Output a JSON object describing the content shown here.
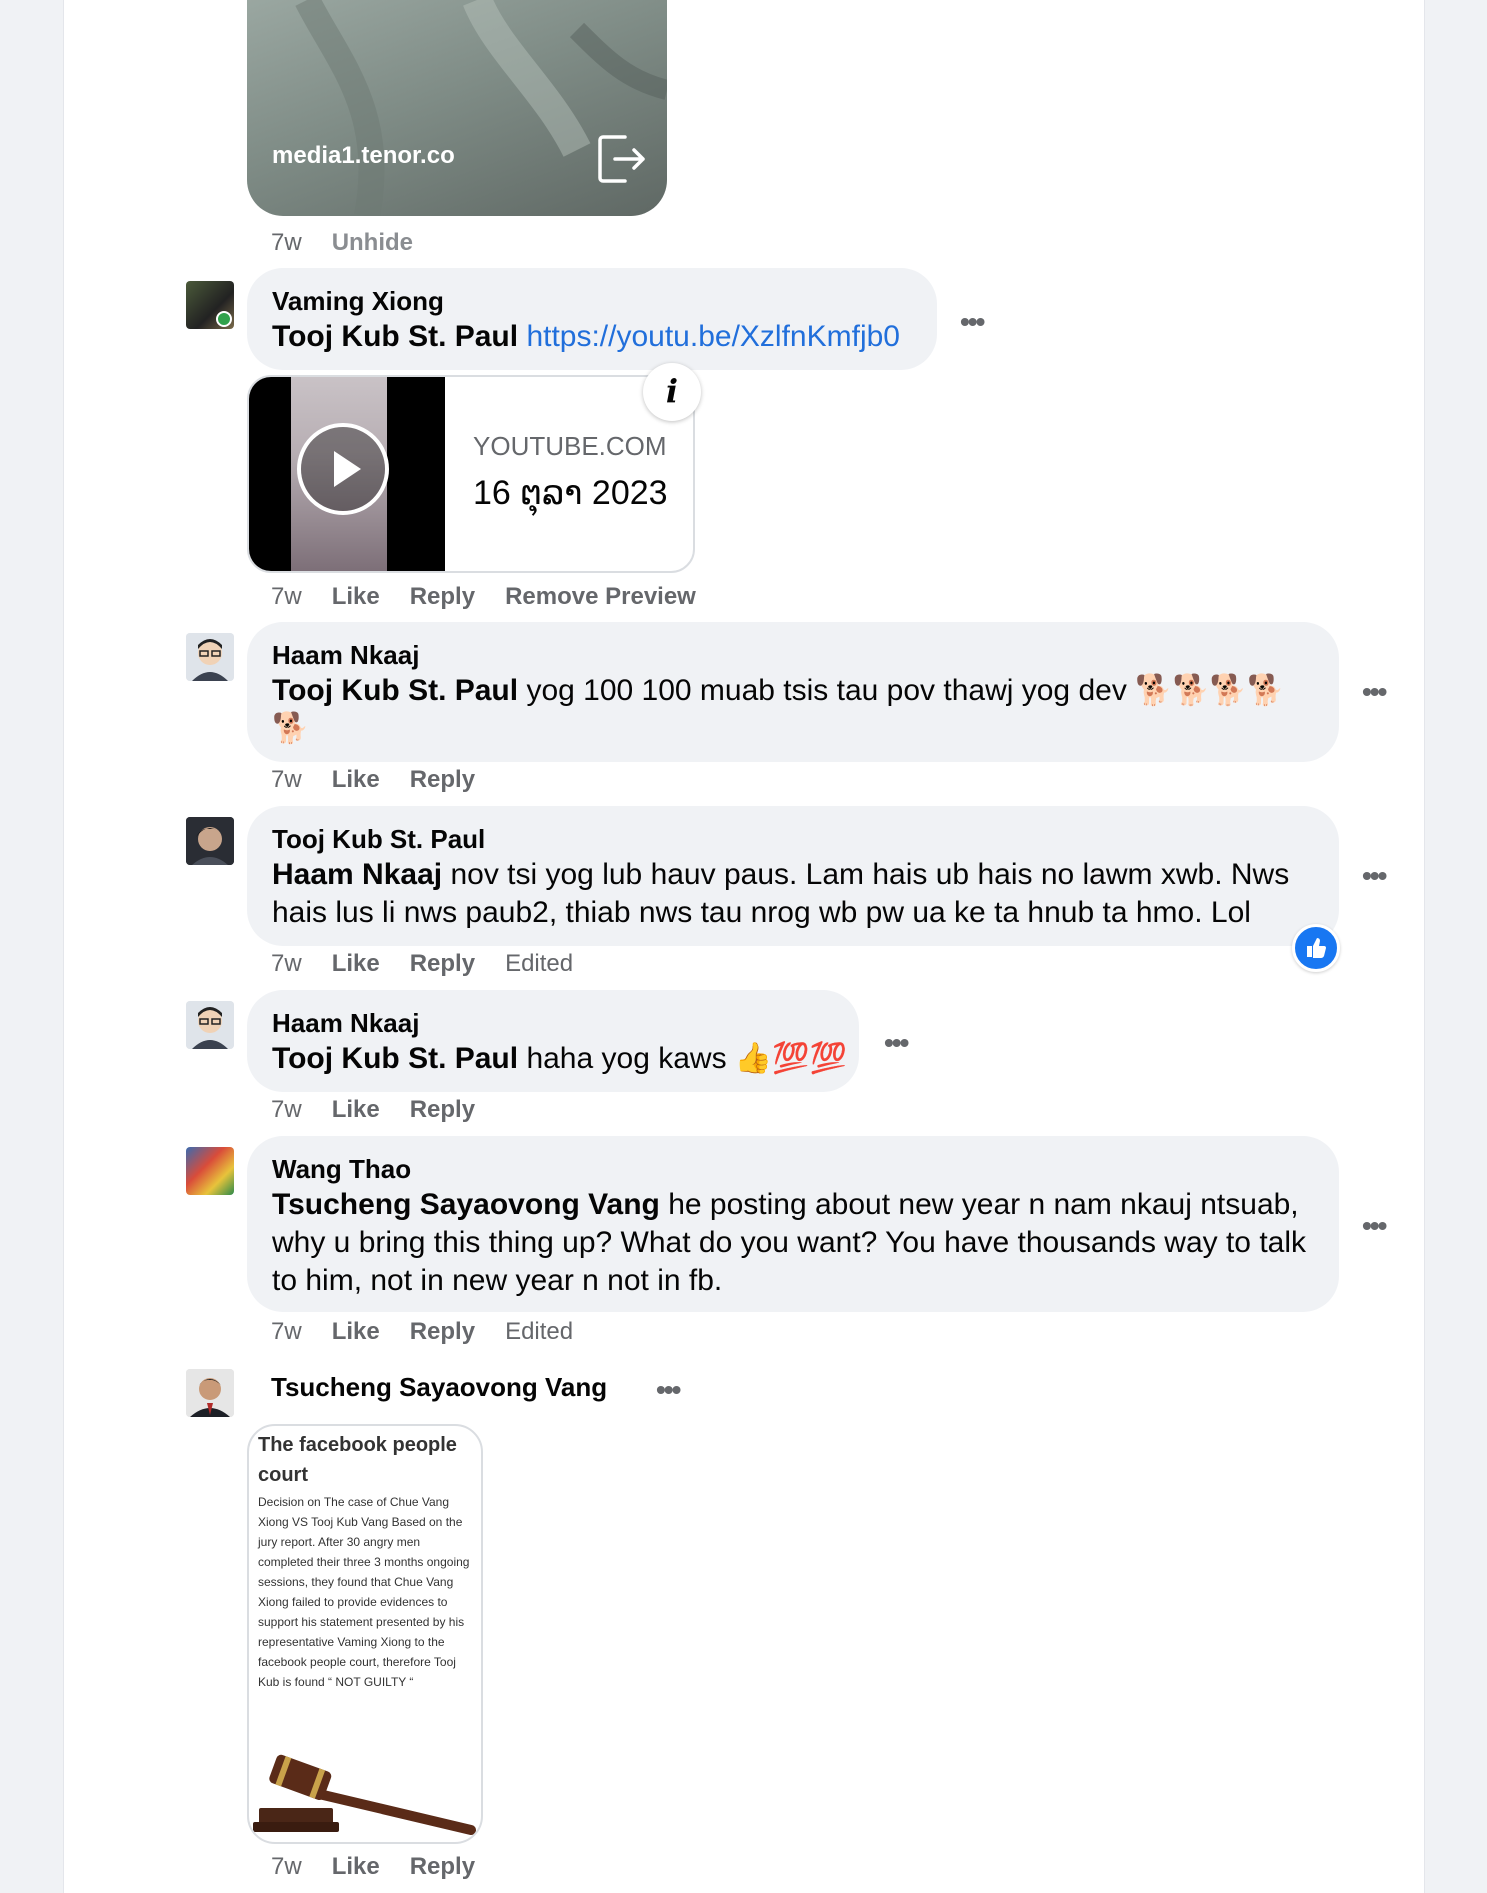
{
  "comments": [
    {
      "kind": "gif",
      "gif_source": "media1.tenor.co",
      "time": "7w",
      "actions": [
        "Unhide"
      ]
    },
    {
      "author": "Vaming Xiong",
      "mention": "Tooj Kub St. Paul",
      "text": "",
      "link": "https://youtu.be/XzlfnKmfjb0",
      "preview": {
        "site": "YOUTUBE.COM",
        "date": "16 ຕຸລາ 2023"
      },
      "time": "7w",
      "actions": [
        "Like",
        "Reply",
        "Remove Preview"
      ]
    },
    {
      "author": "Haam Nkaaj",
      "mention": "Tooj Kub St. Paul",
      "text": "yog 100 100 muab tsis tau pov thawj yog dev 🐕🐕🐕🐕",
      "text2": "🐕",
      "time": "7w",
      "actions": [
        "Like",
        "Reply"
      ]
    },
    {
      "author": "Tooj Kub St. Paul",
      "mention": "Haam Nkaaj",
      "text": "nov tsi yog lub hauv paus. Lam hais ub hais no lawm xwb. Nws hais lus li nws paub2, thiab nws tau nrog wb pw ua ke ta hnub ta hmo. Lol",
      "time": "7w",
      "actions": [
        "Like",
        "Reply"
      ],
      "edited": "Edited",
      "reaction": "like-reaction"
    },
    {
      "author": "Haam Nkaaj",
      "mention": "Tooj Kub St. Paul",
      "text": "haha yog kaws 👍💯💯",
      "time": "7w",
      "actions": [
        "Like",
        "Reply"
      ]
    },
    {
      "author": "Wang Thao",
      "mention": "Tsucheng Sayaovong Vang",
      "text": "he posting about new year n nam nkauj ntsuab, why u bring this thing up? What do you want? You have thousands way to talk to him, not in new year n not in fb.",
      "time": "7w",
      "actions": [
        "Like",
        "Reply"
      ],
      "edited": "Edited"
    },
    {
      "author": "Tsucheng Sayaovong Vang",
      "image": {
        "title": "The facebook people court",
        "body": "Decision on The case of Chue Vang Xiong VS Tooj Kub Vang Based on the jury report. After 30 angry men completed their three 3 months ongoing sessions, they found that Chue Vang Xiong failed to provide evidences to support his statement presented by his representative Vaming Xiong to the facebook people court, therefore Tooj Kub is found “ NOT GUILTY “"
      },
      "time": "7w",
      "actions": [
        "Like",
        "Reply"
      ]
    }
  ],
  "icons": {
    "more": "more-options-icon",
    "share": "external-link-icon",
    "info": "info-icon",
    "play": "play-icon",
    "like_reaction": "thumbs-up-icon",
    "gavel": "gavel-icon"
  },
  "colors": {
    "page_bg": "#f0f2f5",
    "bubble_bg": "#f0f2f5",
    "link": "#216fdb",
    "meta": "#65676b",
    "like_blue": "#1877f2"
  }
}
